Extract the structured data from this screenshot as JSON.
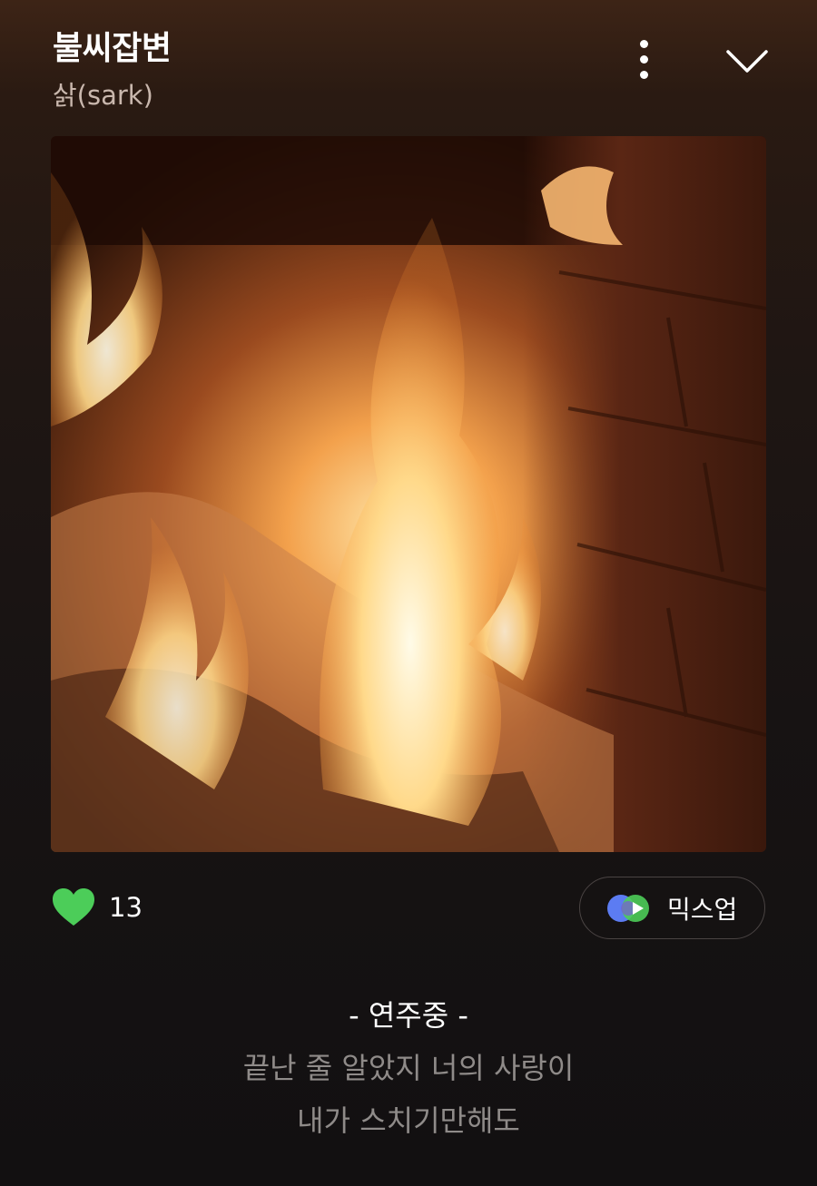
{
  "song": {
    "title": "불씨잡변",
    "artist": "삵(sark)"
  },
  "icons": {
    "more": "more-vertical-icon",
    "collapse": "chevron-down-icon",
    "like": "heart-icon",
    "mixup": "mixup-icon"
  },
  "likes": {
    "count": "13",
    "liked": true,
    "color": "#4ccd59"
  },
  "mixup": {
    "label": "믹스업"
  },
  "lyrics": {
    "status": "- 연주중 -",
    "lines": [
      "끝난 줄 알았지 너의 사랑이",
      "내가 스치기만해도"
    ]
  },
  "colors": {
    "lyric_active": "#ffffff",
    "lyric_inactive": "#8f8b89",
    "mixup_blue": "#5c7cf2",
    "mixup_green": "#4ccd59"
  }
}
